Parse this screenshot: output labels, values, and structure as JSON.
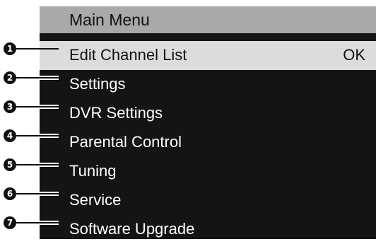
{
  "menu": {
    "title": "Main Menu",
    "items": [
      {
        "number": "1",
        "label": "Edit Channel List",
        "status": "OK"
      },
      {
        "number": "2",
        "label": "Settings",
        "status": ""
      },
      {
        "number": "3",
        "label": "DVR Settings",
        "status": ""
      },
      {
        "number": "4",
        "label": "Parental Control",
        "status": ""
      },
      {
        "number": "5",
        "label": "Tuning",
        "status": ""
      },
      {
        "number": "6",
        "label": "Service",
        "status": ""
      },
      {
        "number": "7",
        "label": "Software Upgrade",
        "status": ""
      }
    ]
  },
  "colors": {
    "panel_background": "#141414",
    "header_background": "#a9a9a9",
    "selected_background": "#dcdcdc",
    "text_light": "#ffffff",
    "text_dark": "#111111"
  }
}
